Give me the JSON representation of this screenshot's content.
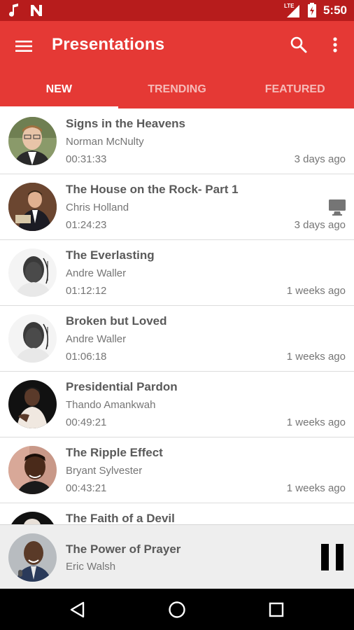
{
  "status_bar": {
    "time": "5:50",
    "network": "LTE",
    "icons": [
      "music-note-icon",
      "n-notification-icon",
      "signal-icon",
      "battery-charging-icon"
    ]
  },
  "app_bar": {
    "title": "Presentations",
    "icons": [
      "menu-icon",
      "search-icon",
      "more-vert-icon"
    ]
  },
  "tabs": [
    {
      "label": "NEW",
      "active": true
    },
    {
      "label": "TRENDING",
      "active": false
    },
    {
      "label": "FEATURED",
      "active": false
    }
  ],
  "presentations": [
    {
      "title": "Signs in the Heavens",
      "speaker": "Norman McNulty",
      "duration": "00:31:33",
      "posted": "3 days ago"
    },
    {
      "title": "The House on the Rock- Part 1",
      "speaker": "Chris Holland",
      "duration": "01:24:23",
      "posted": "3 days ago",
      "badge_icon": "desktop-icon"
    },
    {
      "title": "The Everlasting",
      "speaker": "Andre Waller",
      "duration": "01:12:12",
      "posted": "1 weeks ago"
    },
    {
      "title": "Broken but Loved",
      "speaker": "Andre Waller",
      "duration": "01:06:18",
      "posted": "1 weeks ago"
    },
    {
      "title": "Presidential Pardon",
      "speaker": "Thando Amankwah",
      "duration": "00:49:21",
      "posted": "1 weeks ago"
    },
    {
      "title": "The Ripple Effect",
      "speaker": "Bryant Sylvester",
      "duration": "00:43:21",
      "posted": "1 weeks ago"
    },
    {
      "title": "The Faith of a Devil",
      "speaker": "",
      "duration": "",
      "posted": ""
    }
  ],
  "now_playing": {
    "title": "The Power of Prayer",
    "speaker": "Eric Walsh",
    "control_icon": "pause-icon"
  },
  "nav_bar": {
    "icons": [
      "back-icon",
      "home-icon",
      "recents-icon"
    ]
  },
  "colors": {
    "primary": "#e53935",
    "primary_dark": "#b71c1c",
    "title_text": "#5a5a5a",
    "secondary_text": "#757575",
    "player_bg": "#eeeeee"
  }
}
